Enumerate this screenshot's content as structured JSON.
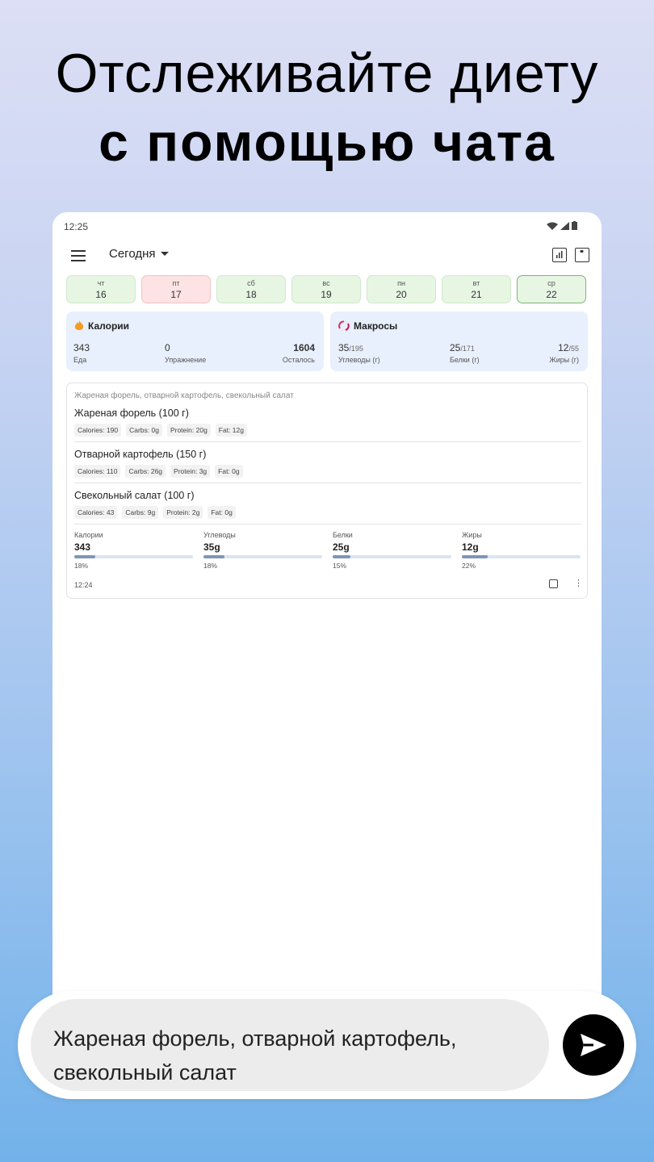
{
  "headline": {
    "line1": "Отслеживайте диету",
    "line2": "с помощью чата"
  },
  "status_bar": {
    "time": "12:25"
  },
  "app_bar": {
    "date_select": "Сегодня",
    "icons": [
      "menu-icon",
      "chart-icon",
      "scale-icon"
    ]
  },
  "days": [
    {
      "dow": "чт",
      "num": "16",
      "state": "green"
    },
    {
      "dow": "пт",
      "num": "17",
      "state": "red"
    },
    {
      "dow": "сб",
      "num": "18",
      "state": "green"
    },
    {
      "dow": "вс",
      "num": "19",
      "state": "green"
    },
    {
      "dow": "пн",
      "num": "20",
      "state": "green"
    },
    {
      "dow": "вт",
      "num": "21",
      "state": "green"
    },
    {
      "dow": "ср",
      "num": "22",
      "state": "selected"
    }
  ],
  "calories_card": {
    "title": "Калории",
    "food": {
      "value": "343",
      "label": "Еда"
    },
    "exercise": {
      "value": "0",
      "label": "Упражнение"
    },
    "remaining": {
      "value": "1604",
      "label": "Осталось"
    }
  },
  "macros_card": {
    "title": "Макросы",
    "carbs": {
      "value": "35",
      "total": "/195",
      "label": "Углеводы (г)"
    },
    "protein": {
      "value": "25",
      "total": "/171",
      "label": "Белки (г)"
    },
    "fat": {
      "value": "12",
      "total": "/55",
      "label": "Жиры (г)"
    }
  },
  "entry": {
    "query": "Жареная форель, отварной картофель, свекольный салат",
    "foods": [
      {
        "name": "Жареная форель (100 г)",
        "calories": "Calories: 190",
        "carbs": "Carbs: 0g",
        "protein": "Protein: 20g",
        "fat": "Fat: 12g"
      },
      {
        "name": "Отварной картофель (150 г)",
        "calories": "Calories: 110",
        "carbs": "Carbs: 26g",
        "protein": "Protein: 3g",
        "fat": "Fat: 0g"
      },
      {
        "name": "Свекольный салат (100 г)",
        "calories": "Calories: 43",
        "carbs": "Carbs: 9g",
        "protein": "Protein: 2g",
        "fat": "Fat: 0g"
      }
    ],
    "totals": [
      {
        "label": "Калории",
        "value": "343",
        "percent": "18%",
        "fraction": 0.18
      },
      {
        "label": "Углеводы",
        "value": "35g",
        "percent": "18%",
        "fraction": 0.18
      },
      {
        "label": "Белки",
        "value": "25g",
        "percent": "15%",
        "fraction": 0.15
      },
      {
        "label": "Жиры",
        "value": "12g",
        "percent": "22%",
        "fraction": 0.22
      }
    ],
    "time": "12:24"
  },
  "chat": {
    "line1": "Жареная форель, отварной картофель,",
    "line2": "свекольный салат"
  },
  "colors": {
    "accent_green": "#e6f6e3",
    "accent_red": "#fde3e3",
    "card_blue": "#e8f0fd",
    "bar_fill": "#7d96b8"
  }
}
